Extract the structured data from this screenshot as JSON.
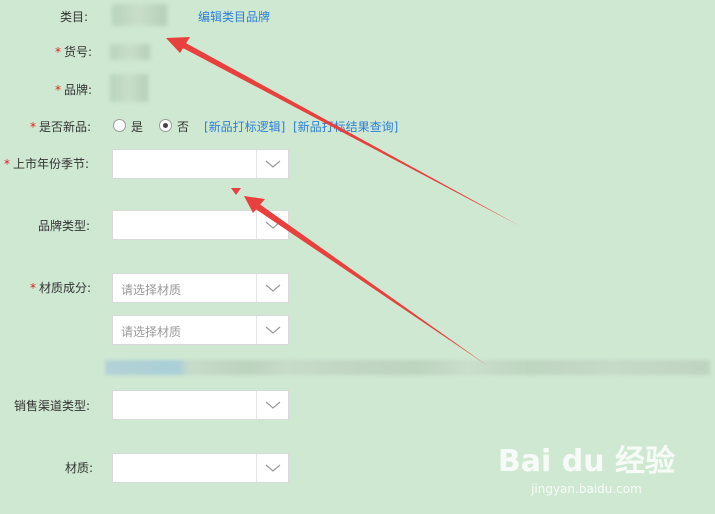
{
  "form": {
    "category_label": "类目:",
    "edit_category_brand_link": "编辑类目品牌",
    "item_no_label": "货号:",
    "brand_label": "品牌:",
    "is_new_label": "是否新品:",
    "new_yes": "是",
    "new_no": "否",
    "new_logic_link": "[新品打标逻辑]",
    "new_result_link": "[新品打标结果查询]",
    "season_label": "上市年份季节:",
    "brand_type_label": "品牌类型:",
    "material_comp_label": "材质成分:",
    "material_placeholder_1": "请选择材质",
    "material_placeholder_2": "请选择材质",
    "sales_channel_label": "销售渠道类型:",
    "material_label": "材质:",
    "required_mark": "*"
  },
  "watermark": {
    "main": "Bai du 经验",
    "sub": "jingyan.baidu.com"
  },
  "colors": {
    "background": "#cfe8d2",
    "link": "#2f7fd6",
    "required": "#e02020",
    "arrow": "#e8403c"
  },
  "icons": {
    "dropdown": "chevron-down-icon",
    "annotation": "red-arrow-icon"
  }
}
